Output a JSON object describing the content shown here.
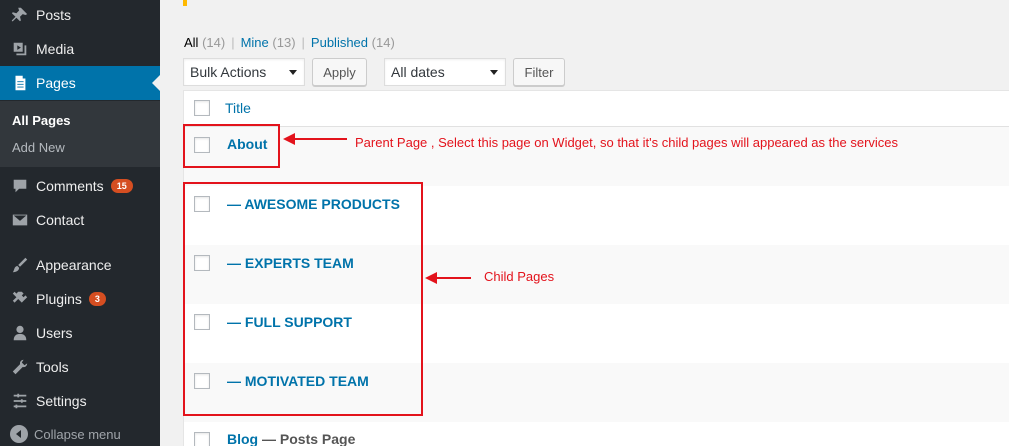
{
  "sidebar": {
    "items": [
      {
        "label": "Posts",
        "icon": "pin-icon"
      },
      {
        "label": "Media",
        "icon": "media-icon"
      },
      {
        "label": "Pages",
        "icon": "pages-icon",
        "active": true
      },
      {
        "label": "Comments",
        "icon": "comment-icon",
        "badge": "15"
      },
      {
        "label": "Contact",
        "icon": "envelope-icon"
      },
      {
        "label": "Appearance",
        "icon": "brush-icon"
      },
      {
        "label": "Plugins",
        "icon": "plug-icon",
        "badge": "3"
      },
      {
        "label": "Users",
        "icon": "user-icon"
      },
      {
        "label": "Tools",
        "icon": "wrench-icon"
      },
      {
        "label": "Settings",
        "icon": "settings-icon"
      }
    ],
    "submenu": [
      {
        "label": "All Pages",
        "current": true
      },
      {
        "label": "Add New"
      }
    ],
    "collapse_label": "Collapse menu"
  },
  "filters": {
    "all": "All",
    "all_count": "(14)",
    "mine": "Mine",
    "mine_count": "(13)",
    "published": "Published",
    "published_count": "(14)",
    "separator": "|"
  },
  "toolbar": {
    "bulk_actions": "Bulk Actions",
    "apply": "Apply",
    "dates": "All dates",
    "filter": "Filter"
  },
  "table": {
    "header": "Title",
    "rows": [
      {
        "title": "About"
      },
      {
        "title": "— AWESOME PRODUCTS"
      },
      {
        "title": "— EXPERTS TEAM"
      },
      {
        "title": "— FULL SUPPORT"
      },
      {
        "title": "— MOTIVATED TEAM"
      },
      {
        "title": "Blog",
        "state": "— Posts Page"
      }
    ]
  },
  "annotations": {
    "parent_note": "Parent Page , Select this page on Widget, so that it's child pages will appeared as the services",
    "child_note": "Child Pages"
  },
  "colors": {
    "sidebar_bg": "#23282d",
    "active_bg": "#0073aa",
    "link": "#0073aa",
    "badge": "#d54e21",
    "annotation": "#e3131c"
  }
}
